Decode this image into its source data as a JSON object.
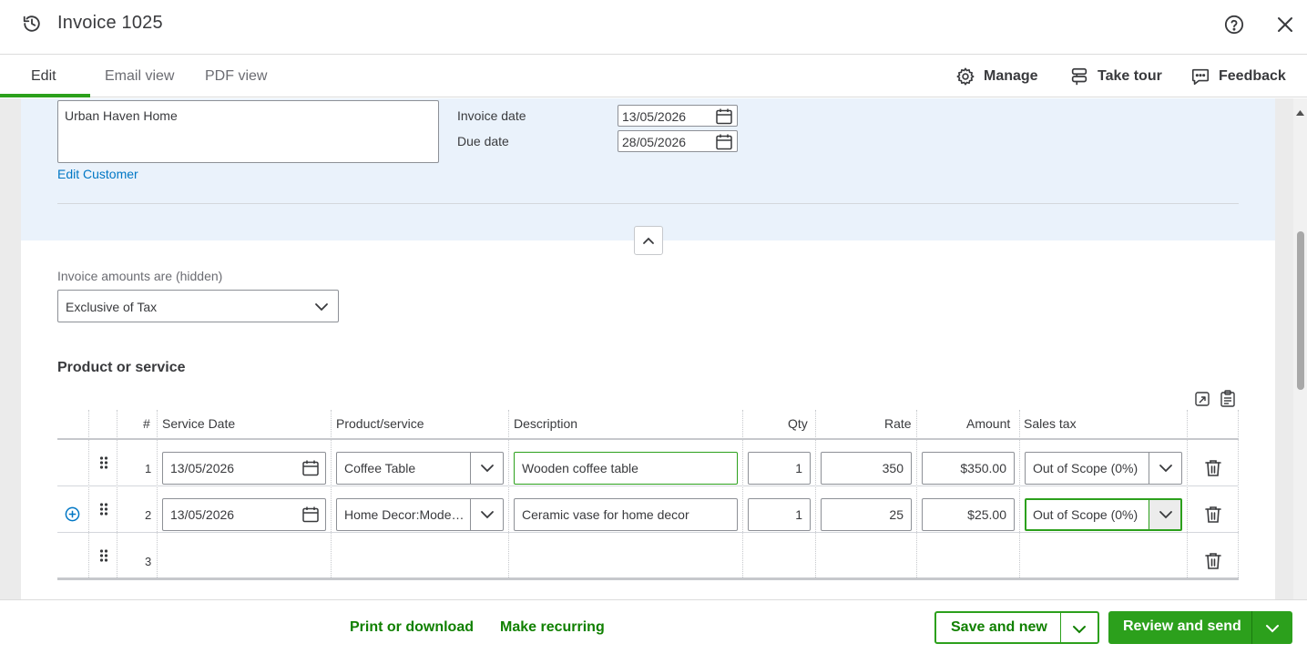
{
  "header": {
    "title": "Invoice 1025"
  },
  "tabs": [
    {
      "label": "Edit"
    },
    {
      "label": "Email view"
    },
    {
      "label": "PDF view"
    }
  ],
  "toolbar": {
    "manage": "Manage",
    "take_tour": "Take tour",
    "feedback": "Feedback"
  },
  "customer": {
    "name": "Urban Haven Home",
    "edit_link": "Edit Customer",
    "invoice_date_label": "Invoice date",
    "invoice_date": "13/05/2026",
    "due_date_label": "Due date",
    "due_date": "28/05/2026"
  },
  "amounts": {
    "label": "Invoice amounts are (hidden)",
    "value": "Exclusive of Tax"
  },
  "products": {
    "title": "Product or service",
    "columns": [
      "#",
      "Service Date",
      "Product/service",
      "Description",
      "Qty",
      "Rate",
      "Amount",
      "Sales tax"
    ],
    "rows": [
      {
        "num": "1",
        "service_date": "13/05/2026",
        "product": "Coffee Table",
        "description": "Wooden coffee table",
        "qty": "1",
        "rate": "350",
        "amount": "$350.00",
        "tax": "Out of Scope (0%)"
      },
      {
        "num": "2",
        "service_date": "13/05/2026",
        "product": "Home Decor:Mode…",
        "description": "Ceramic vase for home decor",
        "qty": "1",
        "rate": "25",
        "amount": "$25.00",
        "tax": "Out of Scope (0%)"
      },
      {
        "num": "3"
      }
    ]
  },
  "footer": {
    "print": "Print or download",
    "recurring": "Make recurring",
    "save_new": "Save and new",
    "review_send": "Review and send"
  },
  "colors": {
    "accent": "#2ca01c",
    "link": "#0077c5",
    "panel_blue": "#eaf2fb"
  }
}
